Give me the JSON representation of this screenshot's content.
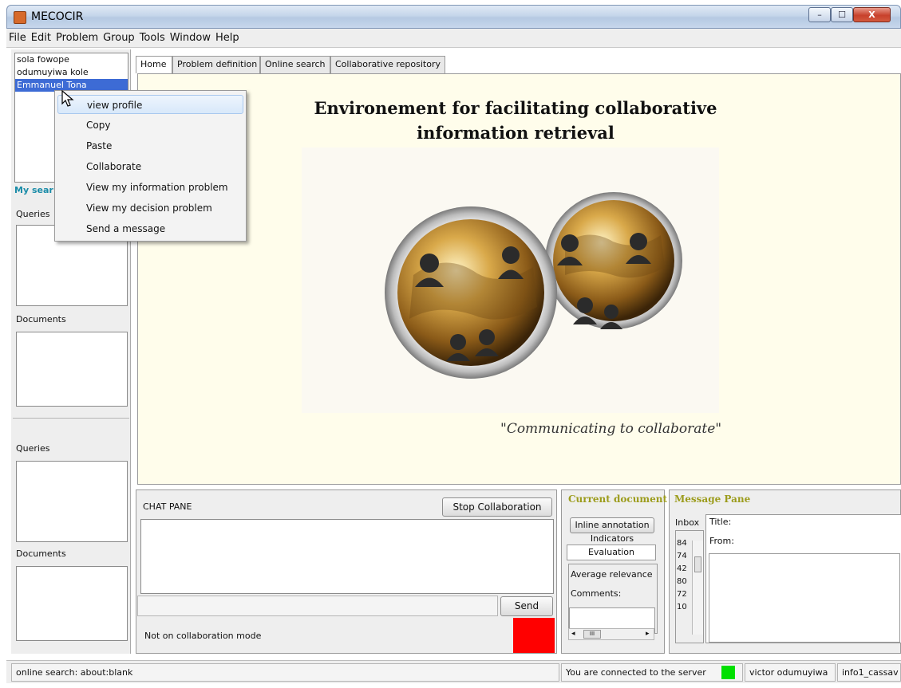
{
  "window": {
    "title": "MECOCIR",
    "minimize_label": "–",
    "maximize_label": "☐",
    "close_label": "X"
  },
  "menubar": {
    "items": [
      "File",
      "Edit",
      "Problem",
      "Group",
      "Tools",
      "Window",
      "Help"
    ]
  },
  "users": {
    "items": [
      "sola fowope",
      "odumuyiwa kole",
      "Emmanuel Tona"
    ],
    "selected_index": 2
  },
  "left_panel": {
    "my_search_label": "My sear",
    "queries_label_1": "Queries",
    "documents_label_1": "Documents",
    "queries_label_2": "Queries",
    "documents_label_2": "Documents"
  },
  "context_menu": {
    "items": [
      "view profile",
      "Copy",
      "Paste",
      "Collaborate",
      "View my information problem",
      "View my decision problem",
      "Send a message"
    ],
    "highlighted_index": 0
  },
  "tabs": {
    "items": [
      "Home",
      "Problem definition",
      "Online search",
      "Collaborative repository"
    ],
    "active_index": 0
  },
  "home": {
    "heading_line1": "Environement for facilitating collaborative",
    "heading_line2": "information retrieval",
    "slogan": "\"Communicating to collaborate\""
  },
  "chat": {
    "title": "CHAT PANE",
    "stop_button": "Stop Collaboration",
    "send_button": "Send",
    "status_text": "Not on collaboration mode",
    "status_color": "#ff0000"
  },
  "current_document": {
    "title": "Current document",
    "inline_annotation_button": "Inline annotation",
    "indicators_label": "Indicators",
    "evaluation_tab": "Evaluation",
    "average_relevance_label": "Average relevance",
    "comments_label": "Comments:",
    "scroll_left": "◂",
    "scroll_right": "▸",
    "scroll_thumb": "III"
  },
  "message_pane": {
    "title": "Message Pane",
    "inbox_label": "Inbox",
    "inbox_items": [
      "84",
      "74",
      "42",
      "80",
      "72",
      "10"
    ],
    "title_field_label": "Title:",
    "from_field_label": "From:"
  },
  "statusbar": {
    "online_search": "online search: about:blank",
    "connection_text": "You are connected to the server",
    "connection_color": "#00e000",
    "user_name": "victor odumuyiwa",
    "database": "info1_cassav"
  }
}
